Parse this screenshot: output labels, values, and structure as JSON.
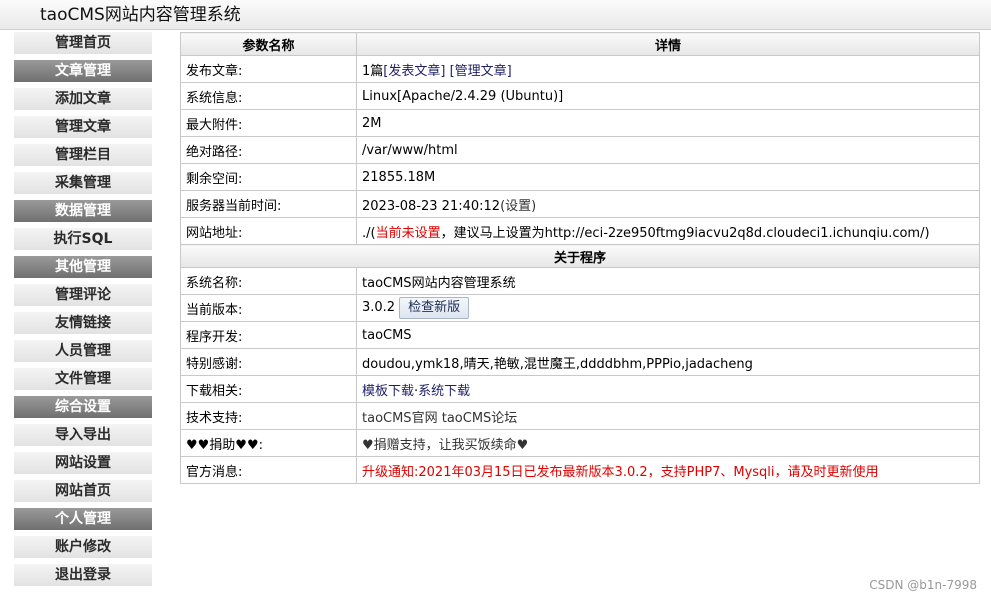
{
  "header": {
    "title": "taoCMS网站内容管理系统"
  },
  "sidebar": {
    "items": [
      {
        "label": "管理首页",
        "type": "link"
      },
      {
        "label": "文章管理",
        "type": "group"
      },
      {
        "label": "添加文章",
        "type": "link"
      },
      {
        "label": "管理文章",
        "type": "link"
      },
      {
        "label": "管理栏目",
        "type": "link"
      },
      {
        "label": "采集管理",
        "type": "link"
      },
      {
        "label": "数据管理",
        "type": "group"
      },
      {
        "label": "执行SQL",
        "type": "link"
      },
      {
        "label": "其他管理",
        "type": "group"
      },
      {
        "label": "管理评论",
        "type": "link"
      },
      {
        "label": "友情链接",
        "type": "link"
      },
      {
        "label": "人员管理",
        "type": "link"
      },
      {
        "label": "文件管理",
        "type": "link"
      },
      {
        "label": "综合设置",
        "type": "group"
      },
      {
        "label": "导入导出",
        "type": "link"
      },
      {
        "label": "网站设置",
        "type": "link"
      },
      {
        "label": "网站首页",
        "type": "link"
      },
      {
        "label": "个人管理",
        "type": "group"
      },
      {
        "label": "账户修改",
        "type": "link"
      },
      {
        "label": "退出登录",
        "type": "link"
      }
    ]
  },
  "params": {
    "col_name": "参数名称",
    "col_detail": "详情",
    "publish": {
      "label": "发布文章:",
      "count": "1篇",
      "link1": "[发表文章]",
      "link2": "[管理文章]"
    },
    "sysinfo": {
      "label": "系统信息:",
      "value": "Linux[Apache/2.4.29 (Ubuntu)]"
    },
    "maxattach": {
      "label": "最大附件:",
      "value": "2M"
    },
    "abspath": {
      "label": "绝对路径:",
      "value": "/var/www/html"
    },
    "space": {
      "label": "剩余空间:",
      "value": "21855.18M"
    },
    "servertime": {
      "label": "服务器当前时间:",
      "value": "2023-08-23 21:40:12",
      "link": "(设置)"
    },
    "siteurl": {
      "label": "网站地址:",
      "prefix": "./(",
      "warn": "当前未设置",
      "suffix": "，建议马上设置为http://eci-2ze950ftmg9iacvu2q8d.cloudeci1.ichunqiu.com/)"
    }
  },
  "about": {
    "header": "关于程序",
    "sysname": {
      "label": "系统名称:",
      "value": "taoCMS网站内容管理系统"
    },
    "version": {
      "label": "当前版本:",
      "value": "3.0.2",
      "button": "检查新版"
    },
    "developer": {
      "label": "程序开发:",
      "value": "taoCMS"
    },
    "thanks": {
      "label": "特别感谢:",
      "value": "doudou,ymk18,晴天,艳敏,混世魔王,ddddbhm,PPPio,jadacheng"
    },
    "download": {
      "label": "下载相关:",
      "link1": "模板下载",
      "sep": "·",
      "link2": "系统下载"
    },
    "support": {
      "label": "技术支持:",
      "link1": "taoCMS官网",
      "link2": "taoCMS论坛"
    },
    "donate": {
      "label": "♥♥捐助♥♥:",
      "value": "♥捐赠支持，让我买饭续命♥"
    },
    "news": {
      "label": "官方消息:",
      "value": "升级通知:2021年03月15日已发布最新版本3.0.2，支持PHP7、Mysqli，请及时更新使用"
    }
  },
  "watermark": "CSDN @b1n-7998",
  "colors": {
    "accent_red": "#e00000",
    "group_bg": "#808080"
  }
}
